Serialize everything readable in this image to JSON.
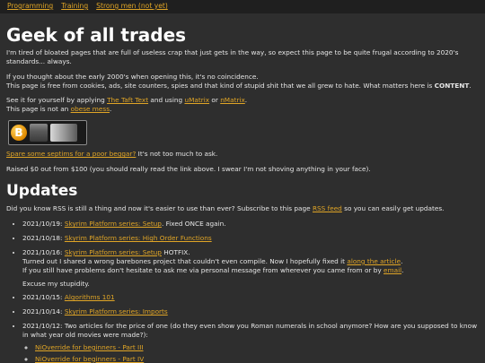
{
  "nav": [
    {
      "label": "Programming"
    },
    {
      "label": "Training"
    },
    {
      "label": "Strong men (not yet)"
    }
  ],
  "title": "Geek of all trades",
  "intro1": "I'm tired of bloated pages that are full of useless crap that just gets in the way, so expect this page to be quite frugal according to 2020's standards... always.",
  "intro2a": "If you thought about the early 2000's when opening this, it's no coincidence.",
  "intro2b_pre": "This page is free from cookies, ads, site counters, spies and that kind of stupid shit that we all grew to hate. What matters here is ",
  "intro2b_bold": "CONTENT",
  "intro2b_post": ".",
  "see_pre": "See it for yourself by applying ",
  "see_link1": "The Taft Text",
  "see_mid": " and using ",
  "see_link2": "uMatrix",
  "see_or": " or ",
  "see_link3": "nMatrix",
  "see_end": ".",
  "notobese_pre": "This page is not an ",
  "notobese_link": "obese mess",
  "notobese_end": ".",
  "badge_coin": "B",
  "spare_link": "Spare some septims for a poor beggar?",
  "spare_rest": " It's not too much to ask.",
  "raised": "Raised $0 out from $100 (you should really read the link above. I swear I'm not shoving anything in your face).",
  "updates_title": "Updates",
  "rss_pre": "Did you know RSS is still a thing and now it's easier to use than ever? Subscribe to this page ",
  "rss_link": "RSS feed",
  "rss_post": " so you can easily get updates.",
  "updates": [
    {
      "date": "2021/10/19: ",
      "link": "Skyrim Platform series: Setup",
      "rest": ". Fixed ONCE again."
    },
    {
      "date": "2021/10/18: ",
      "link": "Skyrim Platform series: High Order Functions",
      "rest": ""
    },
    {
      "date": "2021/10/16: ",
      "link": "Skyrim Platform series: Setup",
      "rest": " HOTFIX."
    }
  ],
  "hotfix_line1_pre": "Turned out I shared a wrong barebones project that couldn't even compile. Now I hopefully fixed it ",
  "hotfix_link": "along the article",
  "hotfix_line1_end": ".",
  "hotfix_line2_pre": "If you still have problems don't hesitate to ask me via personal message from wherever you came from or by ",
  "hotfix_email": "email",
  "hotfix_line2_end": ".",
  "hotfix_line3": "Excuse my stupidity.",
  "updates2": [
    {
      "date": "2021/10/15: ",
      "link": "Algorithms 101",
      "rest": ""
    },
    {
      "date": "2021/10/14: ",
      "link": "Skyrim Platform series: Imports",
      "rest": ""
    }
  ],
  "two_articles": "2021/10/12: Two articles for the price of one (do they even show you Roman numerals in school anymore? How are you supposed to know in what year old movies were made?):",
  "sub_links": [
    {
      "label": "NiOverride for beginners - Part III"
    },
    {
      "label": "NiOverride for beginners - Part IV"
    }
  ]
}
